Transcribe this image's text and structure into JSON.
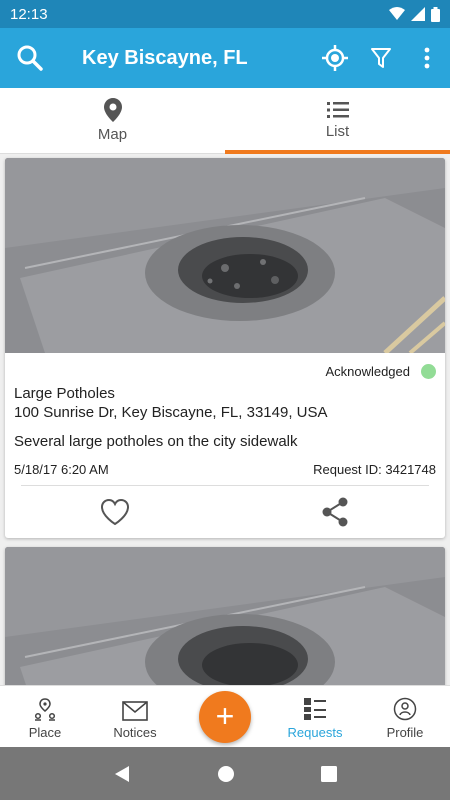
{
  "status_bar": {
    "time": "12:13"
  },
  "app_bar": {
    "title": "Key Biscayne, FL"
  },
  "tabs": [
    {
      "label": "Map",
      "icon": "map-pin-icon",
      "active": false
    },
    {
      "label": "List",
      "icon": "list-icon",
      "active": true
    }
  ],
  "requests": [
    {
      "status": "Acknowledged",
      "status_color": "#92dc96",
      "title": "Large Potholes",
      "address": "100 Sunrise Dr, Key Biscayne, FL, 33149, USA",
      "description": "Several large potholes on the city sidewalk",
      "datetime": "5/18/17 6:20 AM",
      "request_id": "Request ID: 3421748"
    }
  ],
  "bottom_nav": [
    {
      "label": "Place",
      "icon": "place-icon"
    },
    {
      "label": "Notices",
      "icon": "mail-icon"
    },
    {
      "label": "Requests",
      "icon": "requests-icon"
    },
    {
      "label": "Profile",
      "icon": "profile-icon"
    }
  ],
  "fab": {
    "symbol": "+"
  },
  "colors": {
    "primary": "#2aa5db",
    "status_bar": "#1f86b8",
    "accent": "#f07a1e"
  }
}
